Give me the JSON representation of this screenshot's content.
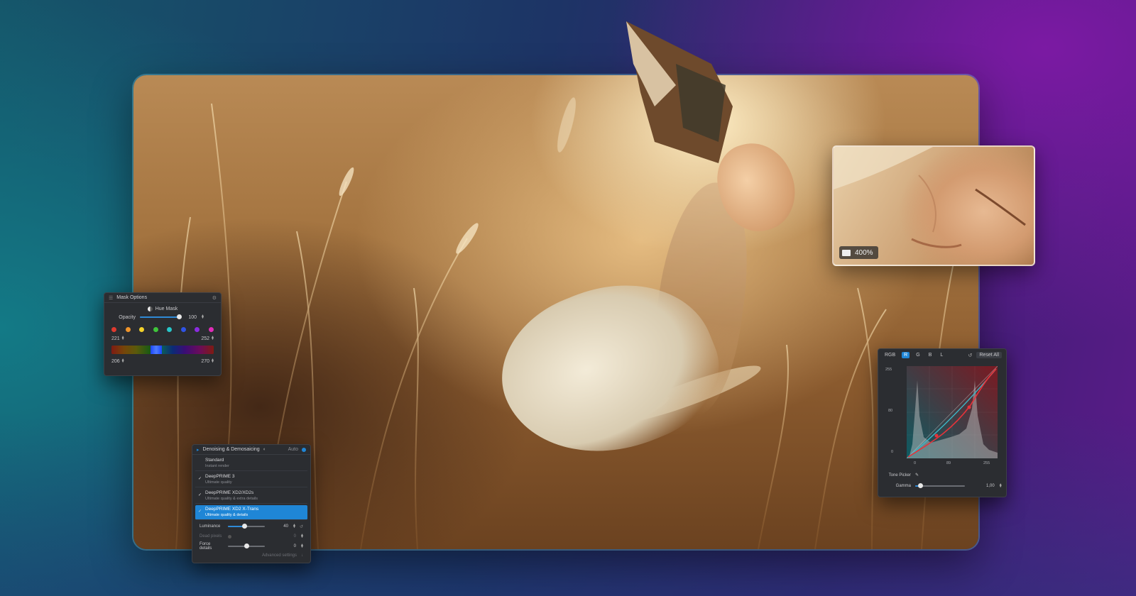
{
  "zoom_inset": {
    "zoom_label": "400%"
  },
  "mask_panel": {
    "title": "Mask Options",
    "mode_label": "Hue Mask",
    "opacity_label": "Opacity",
    "opacity_value": "100",
    "opacity_fraction": 0.95,
    "swatch_colors": [
      "#e03a2f",
      "#f0952b",
      "#f3d22a",
      "#3fc53b",
      "#27c6c9",
      "#2f54e6",
      "#8b2ce0",
      "#e02cb8"
    ],
    "range_low": "221",
    "range_high": "252",
    "range_low_2": "206",
    "range_high_2": "270"
  },
  "denoise_panel": {
    "title": "Denoising & Demosaicing",
    "auto_label": "Auto",
    "options": [
      {
        "title": "Standard",
        "subtitle": "Instant render"
      },
      {
        "title": "DeepPRIME 3",
        "subtitle": "Ultimate quality"
      },
      {
        "title": "DeepPRIME XD2/XD2s",
        "subtitle": "Ultimate quality & extra details"
      },
      {
        "title": "DeepPRIME XD2 X-Trans",
        "subtitle": "Ultimate quality & details"
      }
    ],
    "luminance_label": "Luminance",
    "luminance_value": "40",
    "luminance_fraction": 0.45,
    "dead_pixels_label": "Dead pixels",
    "dead_pixels_value": "0",
    "force_details_label": "Force details",
    "force_details_value": "0",
    "force_details_fraction": 0.5,
    "advanced_label": "Advanced settings"
  },
  "curves_panel": {
    "channels": [
      "RGB",
      "R",
      "G",
      "B",
      "L"
    ],
    "active_channel": "R",
    "reset_label": "Reset All",
    "y_labels": [
      "255",
      "80",
      "0"
    ],
    "x_labels": [
      "0",
      "89",
      "255"
    ],
    "tone_picker_label": "Tone Picker",
    "gamma_label": "Gamma",
    "gamma_value": "1,00",
    "gamma_fraction": 0.1
  },
  "colors": {
    "accent": "#1f86d6",
    "panel_bg": "#2b2d31",
    "curve_red": "#e5333a",
    "curve_cyan": "#3bb7c7"
  }
}
